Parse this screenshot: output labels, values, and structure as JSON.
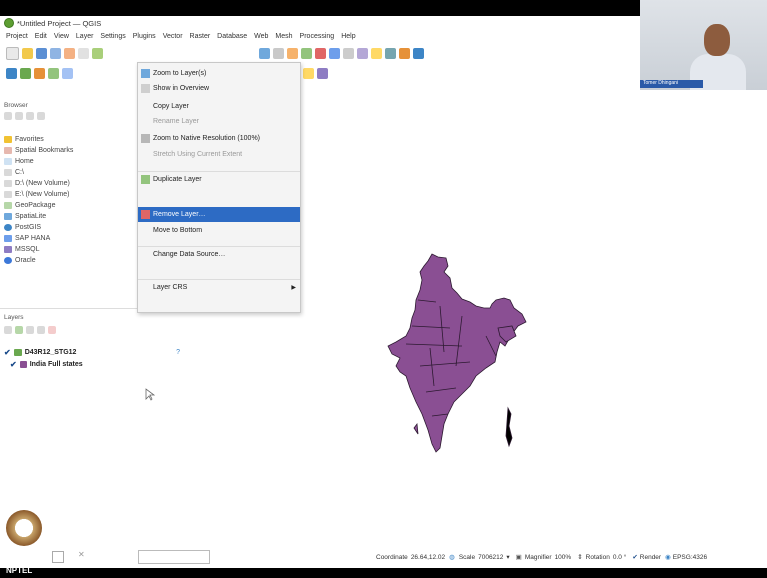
{
  "window": {
    "title": "*Untitled Project — QGIS"
  },
  "menubar": [
    "Project",
    "Edit",
    "View",
    "Layer",
    "Settings",
    "Plugins",
    "Vector",
    "Raster",
    "Database",
    "Web",
    "Mesh",
    "Processing",
    "Help"
  ],
  "webcam": {
    "label": "Tomer Dhingani"
  },
  "browser": {
    "title": "Browser",
    "items": [
      {
        "label": "Favorites",
        "icon": "star-icon"
      },
      {
        "label": "Spatial Bookmarks",
        "icon": "bookmark-icon"
      },
      {
        "label": "Home",
        "icon": "folder-icon"
      },
      {
        "label": "C:\\",
        "icon": "drive-icon"
      },
      {
        "label": "D:\\ (New Volume)",
        "icon": "drive-icon"
      },
      {
        "label": "E:\\ (New Volume)",
        "icon": "drive-icon"
      },
      {
        "label": "GeoPackage",
        "icon": "geopackage-icon"
      },
      {
        "label": "SpatiaLite",
        "icon": "spatialite-icon"
      },
      {
        "label": "PostGIS",
        "icon": "postgis-icon"
      },
      {
        "label": "SAP HANA",
        "icon": "sap-hana-icon"
      },
      {
        "label": "MSSQL",
        "icon": "mssql-icon"
      },
      {
        "label": "Oracle",
        "icon": "oracle-icon"
      }
    ]
  },
  "layers": {
    "title": "Layers",
    "items": [
      {
        "label": "D43R12_STG12",
        "checked": true
      },
      {
        "label": "India Full states",
        "checked": true,
        "color": "#8a4f93"
      }
    ]
  },
  "context_menu": {
    "items": [
      {
        "label": "Zoom to Layer(s)",
        "state": "normal",
        "icon": "zoom-layer-icon"
      },
      {
        "label": "Show in Overview",
        "state": "normal",
        "icon": "overview-icon"
      },
      {
        "label": "Copy Layer",
        "state": "normal",
        "icon": ""
      },
      {
        "label": "Rename Layer",
        "state": "disabled",
        "icon": ""
      },
      {
        "label": "Zoom to Native Resolution (100%)",
        "state": "normal",
        "icon": "zoom-native-icon"
      },
      {
        "label": "Stretch Using Current Extent",
        "state": "disabled",
        "icon": ""
      },
      {
        "label": "Duplicate Layer",
        "state": "normal",
        "icon": "duplicate-icon"
      },
      {
        "label": "Remove Layer…",
        "state": "selected",
        "icon": "remove-layer-icon"
      },
      {
        "label": "Move to Bottom",
        "state": "normal",
        "icon": ""
      },
      {
        "label": "Change Data Source…",
        "state": "normal",
        "icon": ""
      },
      {
        "label": "Layer CRS",
        "state": "normal",
        "icon": ""
      }
    ]
  },
  "map": {
    "fill_color": "#8a4f93"
  },
  "statusbar": {
    "coordinate_label": "Coordinate",
    "coordinate_value": "26.64,12.02",
    "scale_label": "Scale",
    "scale_value": "7006212",
    "magnifier_label": "Magnifier",
    "magnifier_value": "100%",
    "rotation_label": "Rotation",
    "rotation_value": "0.0 °",
    "render_label": "Render",
    "crs_label": "EPSG:4326"
  },
  "branding": {
    "nptel": "NPTEL"
  },
  "colors": {
    "selection": "#2d6bc4",
    "layer_fill": "#8a4f93"
  }
}
